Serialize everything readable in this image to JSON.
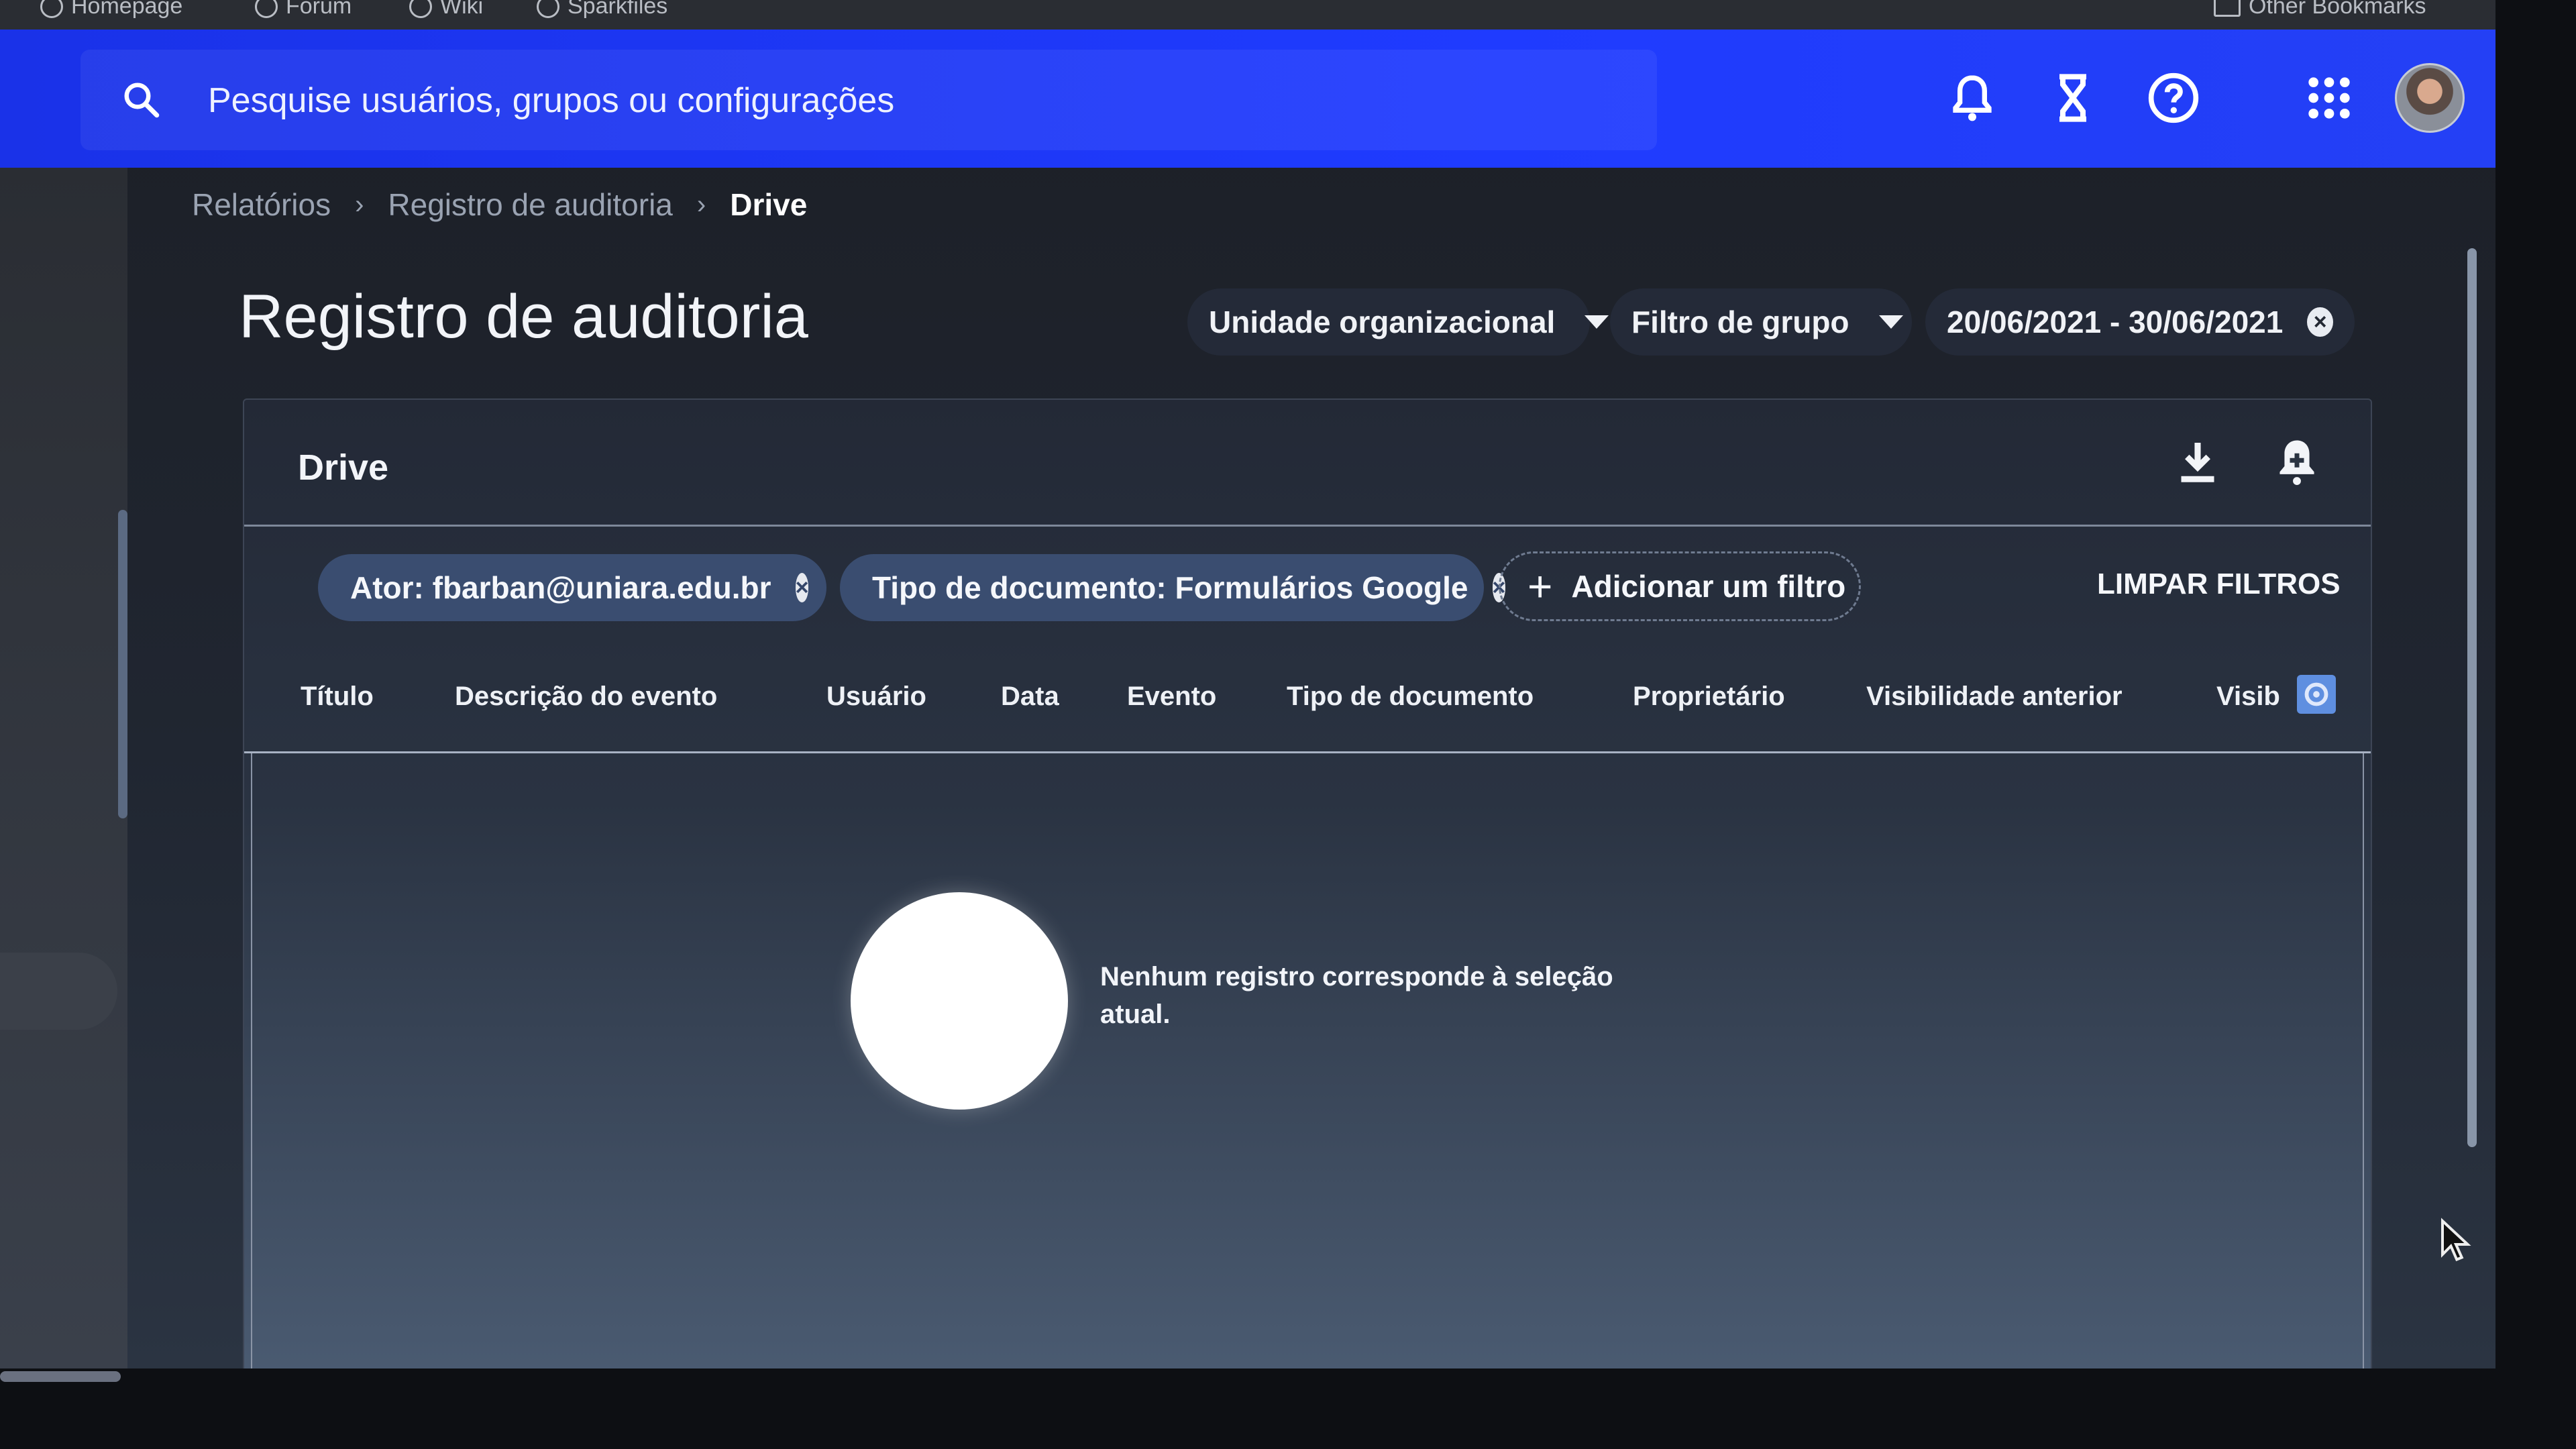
{
  "bookmarks": {
    "items": [
      "Homepage",
      "Forum",
      "Wiki",
      "Sparkfiles"
    ],
    "other": "Other Bookmarks"
  },
  "search": {
    "placeholder": "Pesquise usuários, grupos ou configurações",
    "icon": "search-icon"
  },
  "topbar": {
    "icons": [
      "notifications-icon",
      "hourglass-icon",
      "help-icon",
      "apps-icon"
    ],
    "accent": "#1f3bff"
  },
  "breadcrumb": [
    "Relatórios",
    "Registro de auditoria",
    "Drive"
  ],
  "page": {
    "title": "Registro de auditoria",
    "org_unit": "Unidade organizacional",
    "group_filter": "Filtro de grupo",
    "date_range": "20/06/2021 - 30/06/2021"
  },
  "card": {
    "title": "Drive",
    "download_icon": "download-icon",
    "alert_icon": "add-alert-icon"
  },
  "filters": {
    "chips": [
      "Ator: fbarban@uniara.edu.br",
      "Tipo de documento: Formulários Google"
    ],
    "add_label": "Adicionar um filtro",
    "clear_label": "LIMPAR FILTROS"
  },
  "table": {
    "columns": [
      "Título",
      "Descrição do evento",
      "Usuário",
      "Data",
      "Evento",
      "Tipo de documento",
      "Proprietário",
      "Visibilidade anterior",
      "Visib"
    ],
    "empty_message": "Nenhum registro corresponde à seleção atual."
  }
}
